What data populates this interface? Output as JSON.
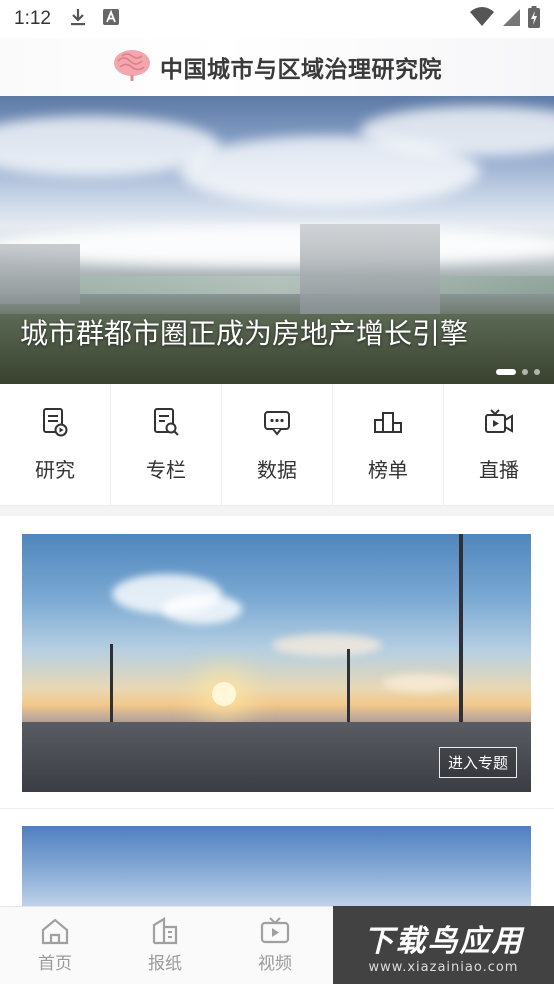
{
  "status_bar": {
    "time": "1:12",
    "icons_left": [
      "download-icon",
      "a-notification-icon"
    ],
    "icons_right": [
      "wifi-icon",
      "signal-icon",
      "battery-charging-icon"
    ]
  },
  "header": {
    "logo_icon": "brain-logo-icon",
    "title": "中国城市与区域治理研究院"
  },
  "banner": {
    "caption": "城市群都市圈正成为房地产增长引擎",
    "slide_count": 3,
    "active_slide": 1
  },
  "quick_nav": [
    {
      "label": "研究",
      "icon": "document-play-icon"
    },
    {
      "label": "专栏",
      "icon": "document-search-icon"
    },
    {
      "label": "数据",
      "icon": "chat-data-icon"
    },
    {
      "label": "榜单",
      "icon": "podium-icon"
    },
    {
      "label": "直播",
      "icon": "video-camera-icon"
    }
  ],
  "feature": {
    "enter_label": "进入专题"
  },
  "tabbar": [
    {
      "label": "首页",
      "icon": "home-icon"
    },
    {
      "label": "报纸",
      "icon": "newspaper-icon"
    },
    {
      "label": "视频",
      "icon": "tv-play-icon"
    }
  ],
  "watermark": {
    "big": "下载鸟应用",
    "small": "www.xiazainiao.com"
  },
  "colors": {
    "text": "#333333",
    "tab_inactive": "#9a9a9a",
    "divider": "#ececec"
  }
}
